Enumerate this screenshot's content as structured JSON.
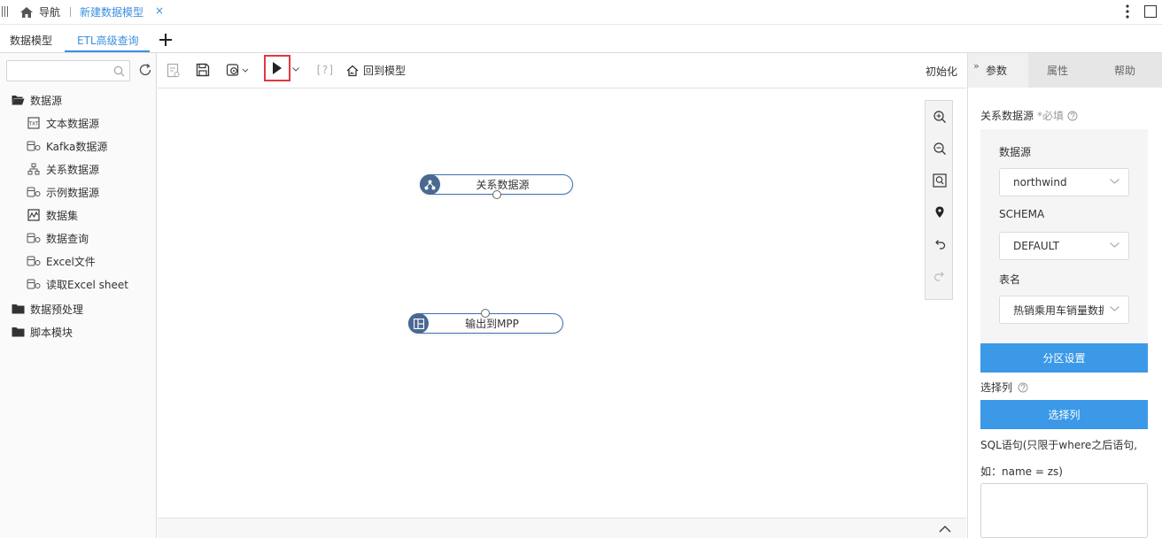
{
  "topbar": {
    "nav_label": "导航",
    "active_tab": "新建数据模型",
    "close_glyph": "×"
  },
  "tabs": {
    "data_model": "数据模型",
    "etl_query": "ETL高级查询",
    "add_glyph": "+"
  },
  "sidebar": {
    "search_placeholder": "",
    "tree": [
      {
        "label": "数据源",
        "icon": "folder-open-icon",
        "level": 0
      },
      {
        "label": "文本数据源",
        "icon": "txt-file-icon",
        "level": 1
      },
      {
        "label": "Kafka数据源",
        "icon": "db-source-icon",
        "level": 1
      },
      {
        "label": "关系数据源",
        "icon": "relational-icon",
        "level": 1
      },
      {
        "label": "示例数据源",
        "icon": "db-source-icon",
        "level": 1
      },
      {
        "label": "数据集",
        "icon": "dataset-chart-icon",
        "level": 1
      },
      {
        "label": "数据查询",
        "icon": "db-source-icon",
        "level": 1
      },
      {
        "label": "Excel文件",
        "icon": "db-source-icon",
        "level": 1
      },
      {
        "label": "读取Excel sheet",
        "icon": "db-source-icon",
        "level": 1
      },
      {
        "label": "数据预处理",
        "icon": "folder-icon",
        "level": 0
      },
      {
        "label": "脚本模块",
        "icon": "folder-icon",
        "level": 0
      }
    ]
  },
  "toolbar": {
    "help_bracket": "[?]",
    "back_to_model": "回到模型",
    "initialize": "初始化"
  },
  "canvas": {
    "nodes": [
      {
        "label": "关系数据源",
        "icon": "relational-node-icon"
      },
      {
        "label": "输出到MPP",
        "icon": "mpp-output-icon"
      }
    ]
  },
  "right_panel": {
    "tabs": [
      "参数",
      "属性",
      "帮助"
    ],
    "expand_glyph": "»",
    "section_label": "关系数据源",
    "required_label": "*必填",
    "fields": {
      "datasource_label": "数据源",
      "datasource_value": "northwind",
      "schema_label": "SCHEMA",
      "schema_value": "DEFAULT",
      "table_label": "表名",
      "table_value": "热销乘用车销量数据"
    },
    "partition_button": "分区设置",
    "select_columns_label": "选择列",
    "select_columns_button": "选择列",
    "sql_hint_line1": "SQL语句(只限于where之后语句,",
    "sql_hint_line2": "如：name = zs)",
    "sql_value": ""
  },
  "colors": {
    "accent": "#3b8fe0",
    "button": "#3b99e8",
    "run_highlight": "#e0393e",
    "node_border": "#3f6fb5",
    "node_icon": "#4a6990"
  }
}
